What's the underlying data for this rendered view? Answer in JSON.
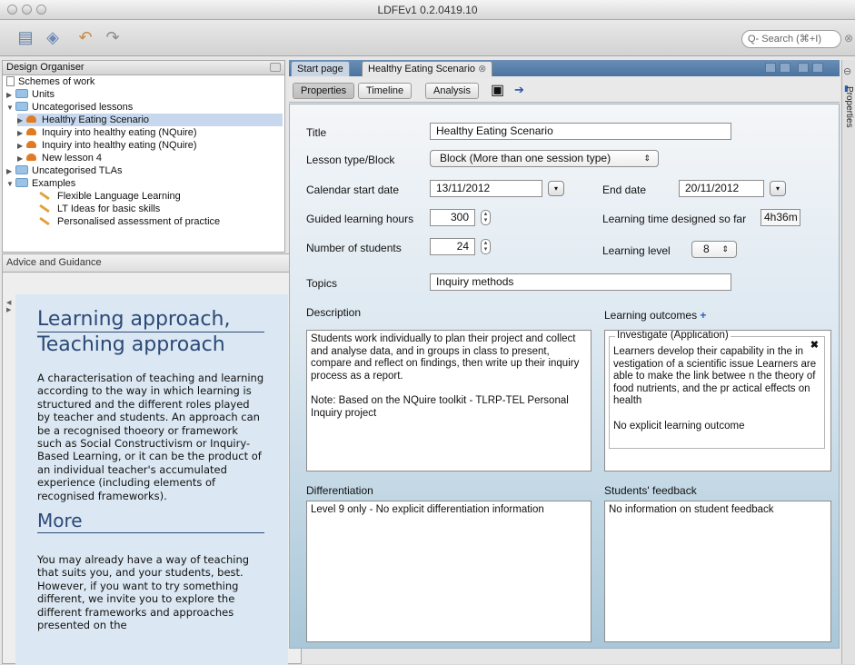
{
  "window": {
    "title": "LDFEv1 0.2.0419.10"
  },
  "toolbar": {
    "search_placeholder": "Q- Search (⌘+I)"
  },
  "organiser": {
    "title": "Design Organiser",
    "items": [
      {
        "label": "Schemes of work"
      },
      {
        "label": "Units"
      },
      {
        "label": "Uncategorised lessons"
      },
      {
        "label": "Healthy Eating Scenario"
      },
      {
        "label": "Inquiry into healthy eating (NQuire)"
      },
      {
        "label": "Inquiry into healthy eating (NQuire)"
      },
      {
        "label": "New lesson 4"
      },
      {
        "label": "Uncategorised TLAs"
      },
      {
        "label": "Examples"
      },
      {
        "label": "Flexible Language Learning"
      },
      {
        "label": "LT Ideas for basic skills"
      },
      {
        "label": "Personalised assessment of practice"
      }
    ]
  },
  "advice": {
    "title": "Advice and Guidance",
    "heading_line1": "Learning approach,",
    "heading_line2": "Teaching approach",
    "paragraph1": "A characterisation of teaching and learning according to the way in which learning is structured and the different roles played by teacher and students. An approach can be a recognised thoeory or framework such as Social Constructivism or Inquiry-Based Learning, or it can be the product of an individual teacher's accumulated experience (including elements of recognised frameworks).",
    "heading_more": "More",
    "paragraph2": "You may already have a way of teaching that suits you, and your students, best. However, if you want to try something different, we invite you to explore the different frameworks and approaches presented on the"
  },
  "tabs": {
    "start": "Start page",
    "current": "Healthy Eating Scenario"
  },
  "subtabs": {
    "properties": "Properties",
    "timeline": "Timeline",
    "analysis": "Analysis"
  },
  "form": {
    "title_label": "Title",
    "title_value": "Healthy Eating Scenario",
    "lesson_type_label": "Lesson type/Block",
    "lesson_type_value": "Block (More than one session type)",
    "start_date_label": "Calendar start date",
    "start_date_value": "13/11/2012",
    "end_date_label": "End date",
    "end_date_value": "20/11/2012",
    "guided_hours_label": "Guided learning hours",
    "guided_hours_value": "300",
    "designed_time_label": "Learning time designed so far",
    "designed_time_value": "4h36m",
    "students_label": "Number of students",
    "students_value": "24",
    "level_label": "Learning level",
    "level_value": "8",
    "topics_label": "Topics",
    "topics_value": "Inquiry methods",
    "description_label": "Description",
    "description_p1": "Students work individually to plan their project and collect and analyse data, and in groups in class to present, compare and reflect on findings, then write up their inquiry process as a report.",
    "description_p2": "Note: Based on the NQuire toolkit - TLRP-TEL Personal Inquiry project",
    "outcomes_label": "Learning outcomes",
    "outcome_group_title": "Investigate (Application)",
    "outcome_text": "Learners develop their capability in the in vestigation of a scientific issue Learners are able to make the link betwee n the theory of food nutrients, and the pr actical effects on health",
    "outcome_none": "No explicit learning outcome",
    "differentiation_label": "Differentiation",
    "differentiation_value": "Level 9 only - No explicit differentiation information",
    "feedback_label": "Students' feedback",
    "feedback_value": "No information on student feedback"
  },
  "side_panel": {
    "label": "Properties"
  }
}
